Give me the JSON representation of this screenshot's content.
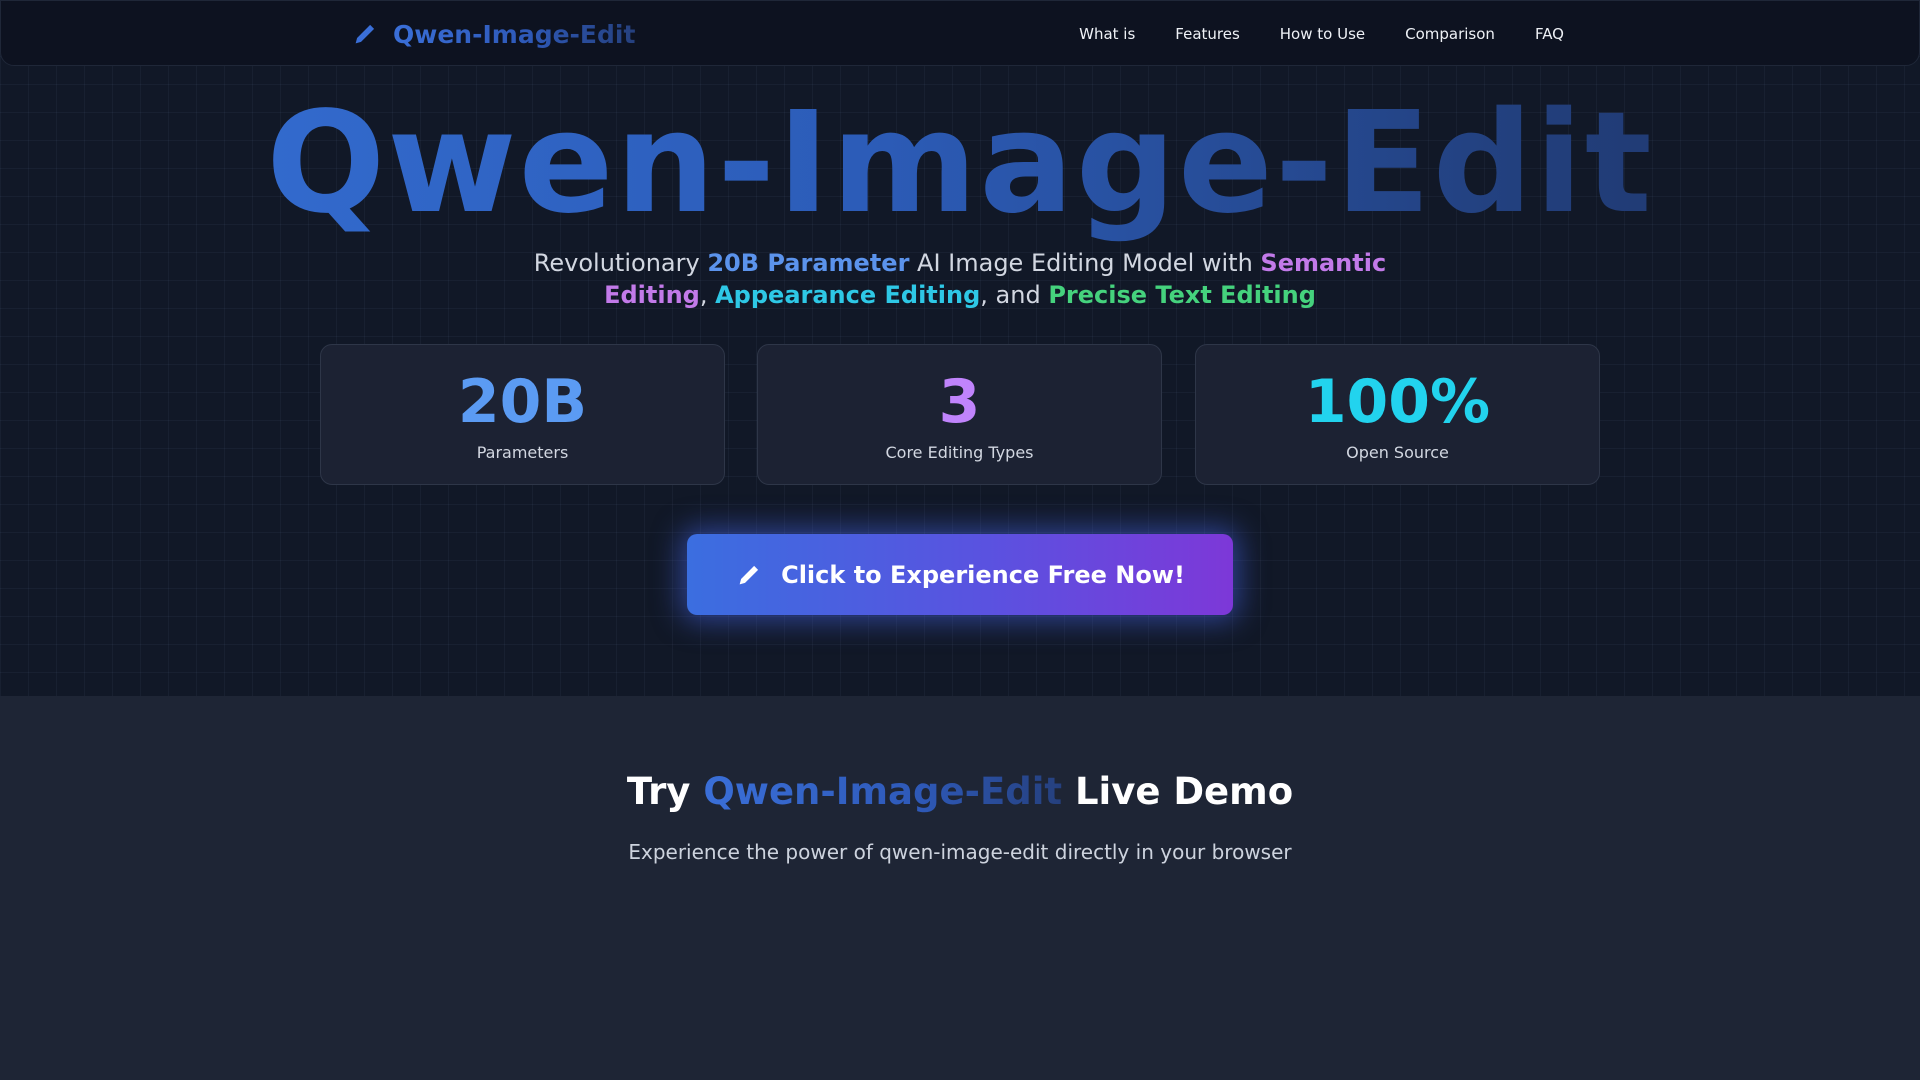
{
  "nav": {
    "brand": "Qwen-Image-Edit",
    "brand_icon": "pencil-icon",
    "links": [
      "What is",
      "Features",
      "How to Use",
      "Comparison",
      "FAQ"
    ]
  },
  "hero": {
    "title": "Qwen-Image-Edit",
    "subtitle": {
      "t1": "Revolutionary ",
      "h1": "20B Parameter",
      "t2": " AI Image Editing Model with ",
      "h2": "Semantic Editing",
      "t3": ", ",
      "h3": "Appearance Editing",
      "t4": ", and ",
      "h4": "Precise Text Editing"
    },
    "stats": [
      {
        "value": "20B",
        "label": "Parameters",
        "color": "#5b9bf3"
      },
      {
        "value": "3",
        "label": "Core Editing Types",
        "color": "#c084fc"
      },
      {
        "value": "100%",
        "label": "Open Source",
        "color": "#22d3ee"
      }
    ],
    "cta": {
      "label": "Click to Experience Free Now!",
      "icon": "pencil-icon"
    }
  },
  "demo": {
    "title_before": "Try ",
    "title_highlight": "Qwen-Image-Edit",
    "title_after": " Live Demo",
    "subtitle": "Experience the power of qwen-image-edit directly in your browser"
  },
  "colors": {
    "accent_blue": "#3b6ee0",
    "accent_purple": "#7d38d8",
    "hero_bg": "#111827",
    "section_bg": "#1e2535"
  }
}
